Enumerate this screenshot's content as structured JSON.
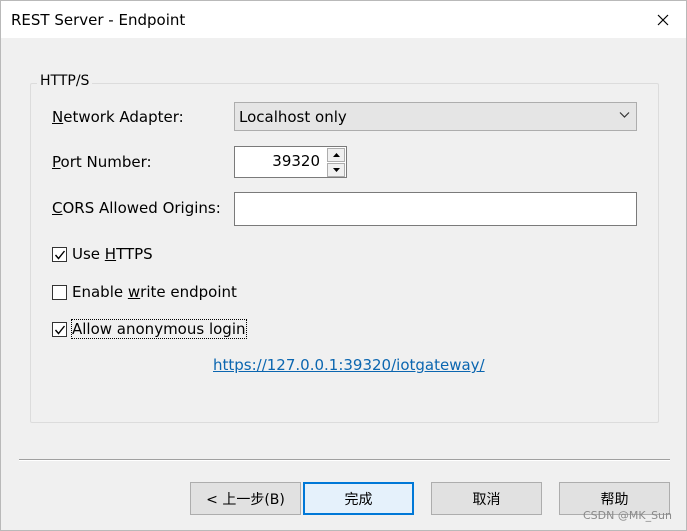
{
  "window": {
    "title": "REST Server - Endpoint"
  },
  "group": {
    "label": "HTTP/S"
  },
  "network_adapter": {
    "label_prefix": "N",
    "label_rest": "etwork Adapter:",
    "value": "Localhost only"
  },
  "port": {
    "label_prefix": "P",
    "label_rest": "ort Number:",
    "value": "39320"
  },
  "cors": {
    "label_prefix": "C",
    "label_rest": "ORS Allowed Origins:",
    "value": ""
  },
  "checkboxes": {
    "https": {
      "before": "Use ",
      "underline": "H",
      "after": "TTPS",
      "checked": true
    },
    "write": {
      "before": "Enable ",
      "underline": "w",
      "after": "rite endpoint",
      "checked": false
    },
    "anon": {
      "before": "Allow anonymous login",
      "underline": "",
      "after": "",
      "checked": true
    }
  },
  "endpoint_url": "https://127.0.0.1:39320/iotgateway/",
  "buttons": {
    "back": "< 上一步(B)",
    "finish": "完成",
    "cancel": "取消",
    "help": "帮助"
  },
  "watermark": "CSDN @MK_Sun"
}
